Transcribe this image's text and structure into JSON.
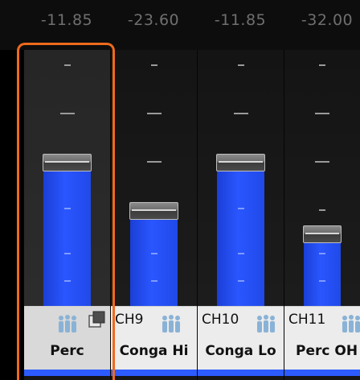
{
  "levels": [
    "-11.85",
    "-23.60",
    "-11.85",
    "-32.00"
  ],
  "channels": [
    {
      "ch": "",
      "name": "Perc",
      "level_fraction": 0.56
    },
    {
      "ch": "CH9",
      "name": "Conga Hi",
      "level_fraction": 0.37
    },
    {
      "ch": "CH10",
      "name": "Conga Lo",
      "level_fraction": 0.56
    },
    {
      "ch": "CH11",
      "name": "Perc OH",
      "level_fraction": 0.28
    }
  ],
  "colors": {
    "accent": "#ee6a1c",
    "fader_fill": "#2a56ff",
    "group_icon": "#8ab2d6"
  },
  "icons": {
    "group": "people-group-icon",
    "copy": "copy-square-icon"
  }
}
